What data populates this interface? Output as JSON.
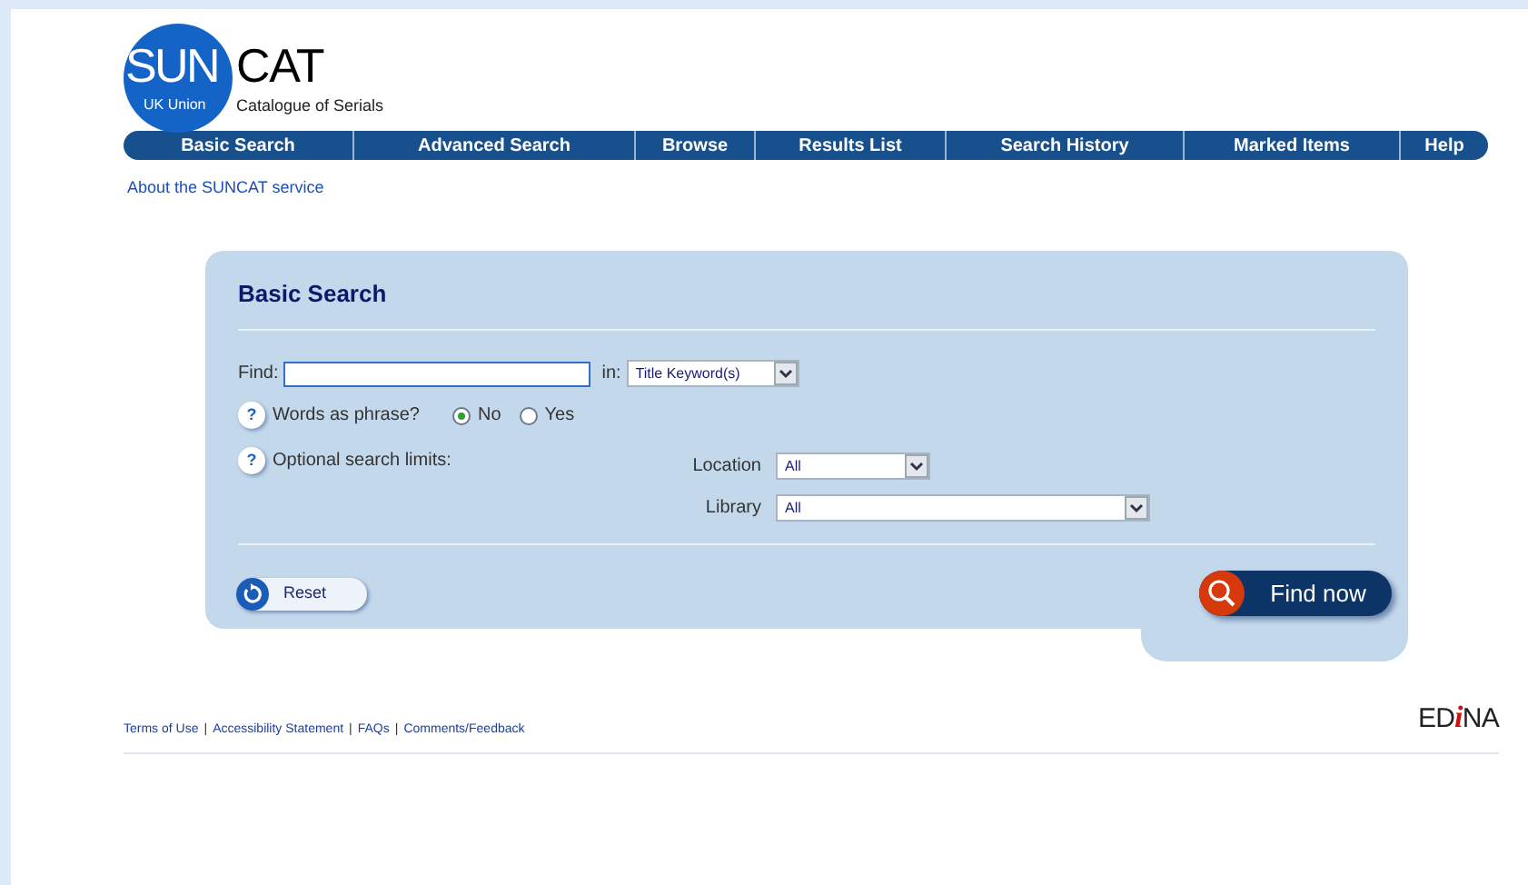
{
  "logo": {
    "circle_text": "SUN",
    "rest_text": "CAT",
    "circle_subtitle": "UK Union",
    "subtitle": "Catalogue of Serials"
  },
  "nav": [
    "Basic Search",
    "Advanced Search",
    "Browse",
    "Results List",
    "Search History",
    "Marked Items",
    "Help"
  ],
  "about_link": "About the SUNCAT service",
  "panel": {
    "title": "Basic Search",
    "find_label": "Find:",
    "in_label": "in:",
    "in_select": "Title Keyword(s)",
    "help_mark": "?",
    "phrase_label": "Words as phrase?",
    "phrase_options": [
      {
        "label": "No",
        "selected": true
      },
      {
        "label": "Yes",
        "selected": false
      }
    ],
    "limits_label": "Optional search limits:",
    "limits": [
      {
        "label": "Location",
        "value": "All",
        "kind": "short"
      },
      {
        "label": "Library",
        "value": "All",
        "kind": "long"
      }
    ],
    "reset_button": "Reset",
    "find_button": "Find now"
  },
  "footer": [
    {
      "kind": "link",
      "text": "Terms of Use"
    },
    {
      "kind": "separator",
      "text": "|"
    },
    {
      "kind": "link",
      "text": "Accessibility Statement"
    },
    {
      "kind": "separator",
      "text": "|"
    },
    {
      "kind": "link",
      "text": "FAQs"
    },
    {
      "kind": "separator",
      "text": "|"
    },
    {
      "kind": "link",
      "text": "Comments/Feedback"
    }
  ],
  "edina_logo": [
    {
      "kind": "plain",
      "text": "ED"
    },
    {
      "kind": "accent",
      "text": "i"
    },
    {
      "kind": "plain",
      "text": "NA"
    }
  ]
}
